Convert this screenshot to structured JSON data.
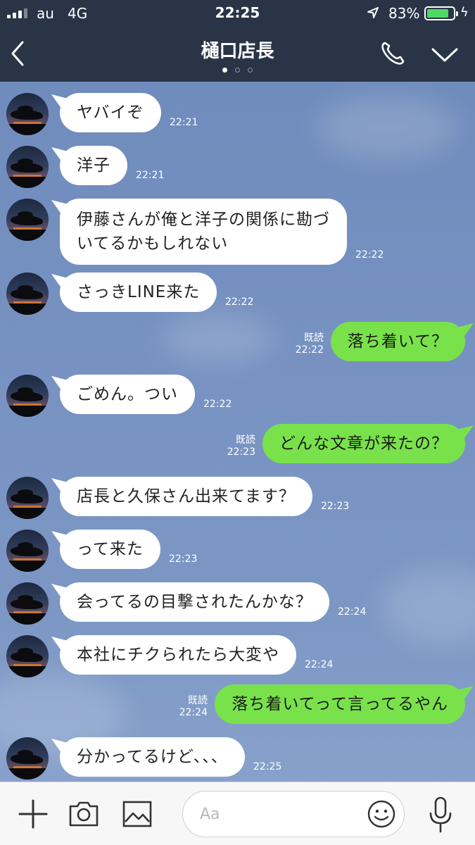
{
  "status_bar": {
    "carrier": "au",
    "network": "4G",
    "time": "22:25",
    "battery_percent": "83%",
    "battery_level": 0.83,
    "icons": [
      "signal-icon",
      "location-arrow-icon",
      "battery-icon",
      "charging-bolt-icon"
    ]
  },
  "header": {
    "title": "樋口店長",
    "page_dots": 3,
    "active_dot": 0,
    "icons": [
      "back-chevron-icon",
      "phone-icon",
      "chevron-down-icon"
    ]
  },
  "messages": [
    {
      "side": "in",
      "lines": [
        "ヤバイぞ"
      ],
      "time": "22:21"
    },
    {
      "side": "in",
      "lines": [
        "洋子"
      ],
      "time": "22:21"
    },
    {
      "side": "in",
      "lines": [
        "伊藤さんが俺と洋子の関係に勘づ",
        "いてるかもしれない"
      ],
      "time": "22:22"
    },
    {
      "side": "in",
      "lines": [
        "さっきLINE来た"
      ],
      "time": "22:22"
    },
    {
      "side": "out",
      "lines": [
        "落ち着いて？"
      ],
      "read": "既読",
      "time": "22:22"
    },
    {
      "side": "in",
      "lines": [
        "ごめん。つい"
      ],
      "time": "22:22"
    },
    {
      "side": "out",
      "lines": [
        "どんな文章が来たの？"
      ],
      "read": "既読",
      "time": "22:23"
    },
    {
      "side": "in",
      "lines": [
        "店長と久保さん出来てます？"
      ],
      "time": "22:23"
    },
    {
      "side": "in",
      "lines": [
        "って来た"
      ],
      "time": "22:23"
    },
    {
      "side": "in",
      "lines": [
        "会ってるの目撃されたんかな？"
      ],
      "time": "22:24"
    },
    {
      "side": "in",
      "lines": [
        "本社にチクられたら大変や"
      ],
      "time": "22:24"
    },
    {
      "side": "out",
      "lines": [
        "落ち着いてって言ってるやん"
      ],
      "read": "既読",
      "time": "22:24"
    },
    {
      "side": "in",
      "lines": [
        "分かってるけど、、、"
      ],
      "time": "22:25"
    }
  ],
  "input_bar": {
    "placeholder": "Aa",
    "icons": [
      "plus-icon",
      "camera-icon",
      "image-icon",
      "emoji-icon",
      "microphone-icon"
    ]
  },
  "colors": {
    "header_bg": "#2a3447",
    "chat_bg": "#7893c2",
    "outgoing_bubble": "#79e24b",
    "incoming_bubble": "#ffffff",
    "battery_fill": "#4cd964"
  }
}
